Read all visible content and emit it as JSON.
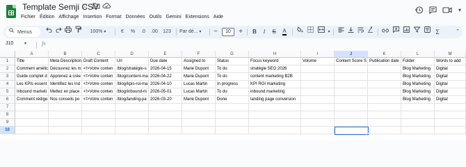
{
  "document": {
    "title": "Template Semji CSV"
  },
  "menu": [
    "Fichier",
    "Édition",
    "Affichage",
    "Insertion",
    "Format",
    "Données",
    "Outils",
    "Gemini",
    "Extensions",
    "Aide"
  ],
  "toolbar": {
    "search_label": "Menus",
    "zoom": "100%",
    "currency": "€",
    "percent": "%",
    "decrease_decimals": ".0",
    "increase_decimals": ".00",
    "number_format": "123",
    "font": "Par dé...",
    "font_size": "10"
  },
  "formula_bar": {
    "cell_ref": "J10",
    "fx": "fx",
    "content": ""
  },
  "grid": {
    "columns": [
      "A",
      "B",
      "C",
      "D",
      "E",
      "F",
      "G",
      "H",
      "I",
      "J",
      "K",
      "L",
      "M"
    ],
    "selected_column": "J",
    "row_numbers": [
      "1",
      "2",
      "3",
      "4",
      "5",
      "6",
      "7",
      "8",
      "9",
      "10"
    ],
    "selected_row": "10",
    "rows": [
      [
        "Title",
        "Meta Description",
        "Draft Content",
        "Url",
        "Due date",
        "Assigned to",
        "Status",
        "Focus keyword",
        "Volume",
        "Content Score S",
        "Publication date",
        "Folder",
        "Words to add"
      ],
      [
        "Comment amélic",
        "Découvrez les m",
        "<!>Votre conten",
        "/blog/stratégie-s",
        "2026-04-15",
        "Marie Dupont",
        "To do",
        "stratégie SEO 2026",
        "",
        "",
        "",
        "Blog Marketing",
        "Digital"
      ],
      [
        "Guide complet d",
        "Apprenez à crée",
        "<!>Votre conten",
        "/blog/content-ma",
        "2026-04-22",
        "Marie Dupont",
        "To do",
        "content marketing B2B",
        "",
        "",
        "",
        "Blog Marketing",
        "Digital"
      ],
      [
        "Les KPIs essent",
        "Identifiez les ind",
        "<!>Votre conten",
        "/blog/kpis-roi-ma",
        "2026-04-10",
        "Lucas Martin",
        "In progress",
        "KPI ROI marketing",
        "",
        "",
        "",
        "Blog Marketing",
        "Digital"
      ],
      [
        "Inbound marketi",
        "Mettez en place",
        "<!>Votre conten",
        "/blog/inbound-m",
        "2026-05-01",
        "Lucas Martin",
        "To do",
        "inbound marketing",
        "",
        "",
        "",
        "Blog Marketing",
        "Digital"
      ],
      [
        "Comment rédige",
        "Nos conseils po",
        "<!>Votre conten",
        "/blog/landing-pa",
        "2026-03-20",
        "Marie Dupont",
        "Done",
        "landing page conversion",
        "",
        "",
        "",
        "Blog Marketing",
        "Digital"
      ],
      [
        "",
        "",
        "",
        "",
        "",
        "",
        "",
        "",
        "",
        "",
        "",
        "",
        ""
      ],
      [
        "",
        "",
        "",
        "",
        "",
        "",
        "",
        "",
        "",
        "",
        "",
        "",
        ""
      ],
      [
        "",
        "",
        "",
        "",
        "",
        "",
        "",
        "",
        "",
        "",
        "",
        "",
        ""
      ],
      [
        "",
        "",
        "",
        "",
        "",
        "",
        "",
        "",
        "",
        "",
        "",
        "",
        ""
      ]
    ]
  },
  "colors": {
    "accent": "#1a73e8",
    "sheets_green": "#188038",
    "toolbar_bg": "#edf2fa",
    "selected_header_bg": "#d3e3fd"
  },
  "icons": [
    "star-icon",
    "move-to-folder-icon",
    "cloud-status-icon",
    "history-icon",
    "comment-icon",
    "video-call-icon",
    "lock-icon"
  ]
}
